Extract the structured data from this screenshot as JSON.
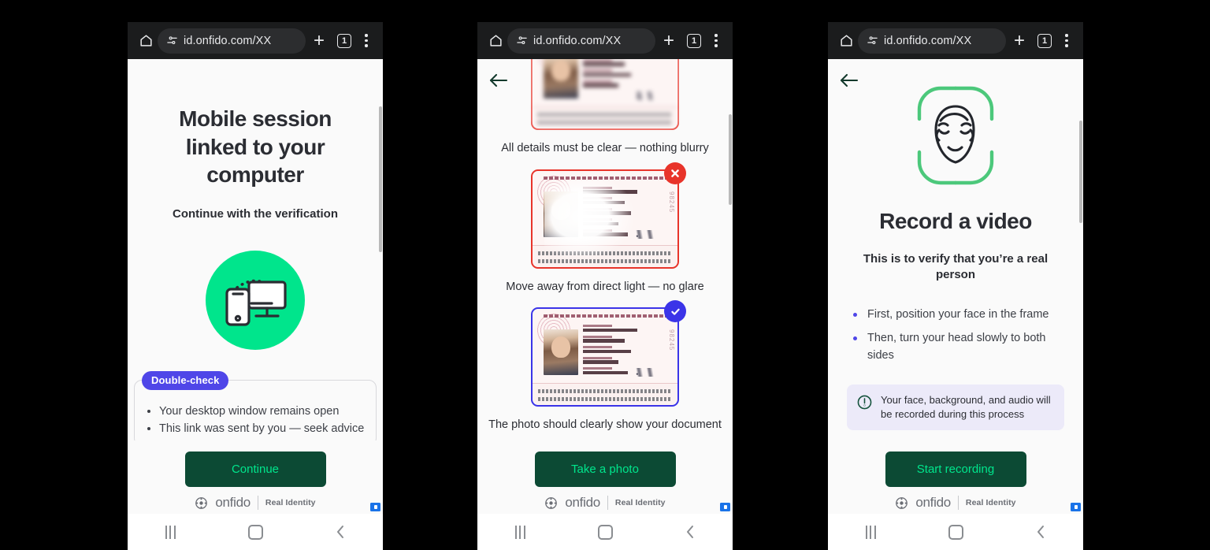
{
  "browser": {
    "url": "id.onfido.com/XX",
    "tab_count": "1",
    "home_icon": "home-icon",
    "site_settings_icon": "site-settings-icon",
    "new_tab_icon": "plus-icon",
    "menu_icon": "three-dot-menu-icon"
  },
  "android_nav": {
    "recents_label": "recent-apps",
    "home_label": "home",
    "back_label": "back"
  },
  "brand": {
    "name": "onfido",
    "tagline": "Real Identity"
  },
  "panels": [
    {
      "id": "mobile-session-linked",
      "title": "Mobile session linked to your computer",
      "subtitle": "Continue with the verification",
      "hero_icon": "phone-and-desktop-icon",
      "card": {
        "badge": "Double-check",
        "items": [
          "Your desktop window remains open",
          "This link was sent by you — seek advice"
        ]
      },
      "button": "Continue"
    },
    {
      "id": "document-photo-guidance",
      "back_icon": "back-arrow-icon",
      "examples": [
        {
          "state": "blurry",
          "badge": "",
          "caption": "All details must be clear — nothing blurry"
        },
        {
          "state": "glare",
          "badge": "x-mark",
          "caption": "Move away from direct light — no glare"
        },
        {
          "state": "good",
          "badge": "check-mark",
          "caption": "The photo should clearly show your document"
        }
      ],
      "button": "Take a photo"
    },
    {
      "id": "record-a-video",
      "back_icon": "back-arrow-icon",
      "hero_icon": "face-in-frame-icon",
      "title": "Record a video",
      "subtitle": "This is to verify that you’re a real person",
      "steps": [
        "First, position your face in the frame",
        "Then, turn your head slowly to both sides"
      ],
      "info": {
        "icon": "exclamation-circle-icon",
        "text": "Your face, background, and audio will be recorded during this process"
      },
      "button": "Start recording"
    }
  ],
  "colors": {
    "brand_green_bright": "#00e58c",
    "button_dark_green": "#0c4a34",
    "accent_indigo": "#4f46e8",
    "error_red": "#e8342a",
    "browser_bar": "#1b1c1d",
    "page_bg": "#fafafa"
  }
}
